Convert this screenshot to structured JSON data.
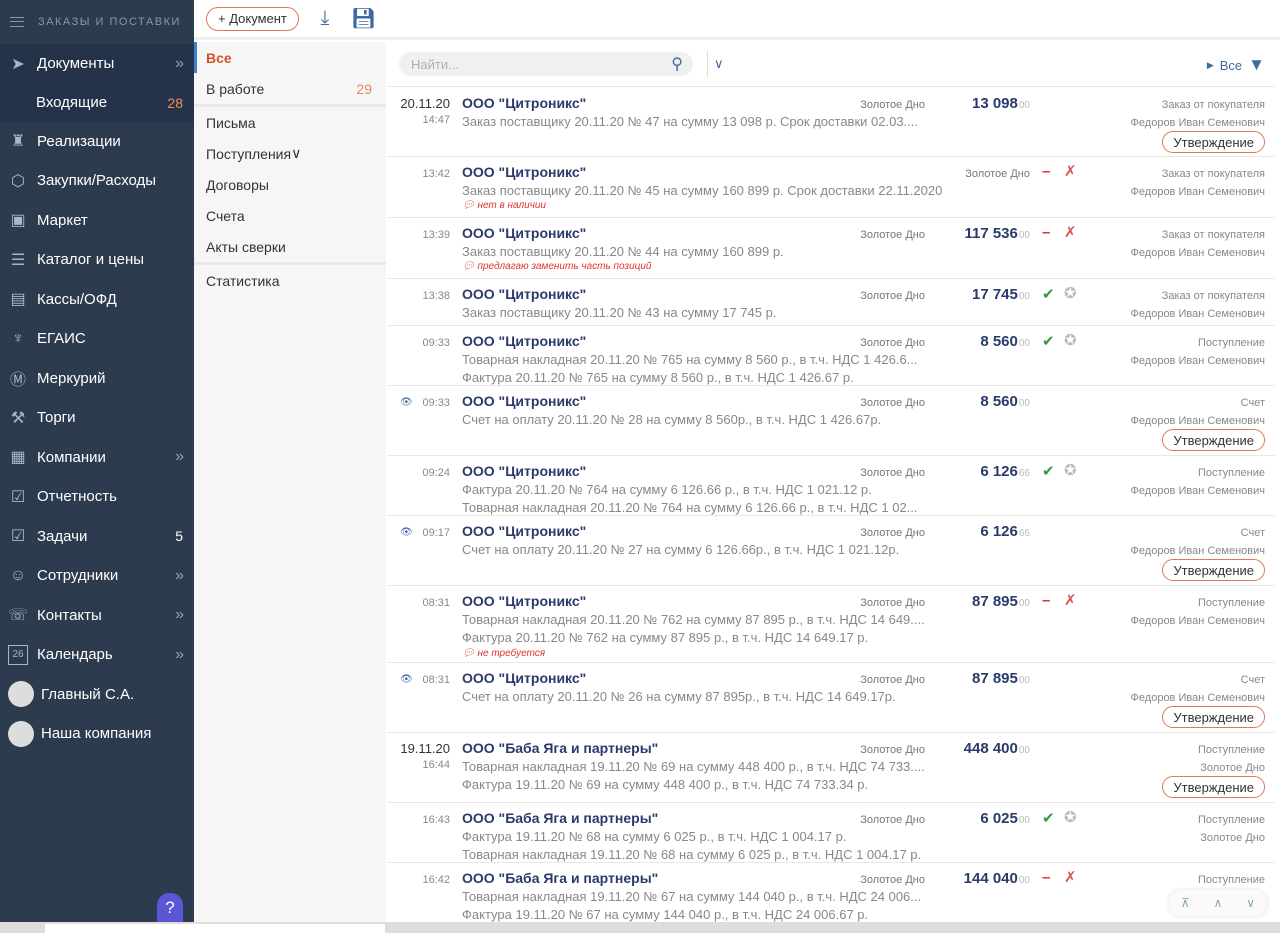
{
  "sidebar": {
    "section": "ЗАКАЗЫ И ПОСТАВКИ",
    "items": [
      {
        "label": "Документы",
        "icon": "paper-plane-icon",
        "glyph": "➤",
        "chev": true
      },
      {
        "label": "Реализации",
        "icon": "hand-coins-icon",
        "glyph": "♜"
      },
      {
        "label": "Закупки/Расходы",
        "icon": "box-icon",
        "glyph": "⬡"
      },
      {
        "label": "Маркет",
        "icon": "cart-icon",
        "glyph": "▣"
      },
      {
        "label": "Каталог и цены",
        "icon": "tray-icon",
        "glyph": "☰"
      },
      {
        "label": "Кассы/ОФД",
        "icon": "cash-register-icon",
        "glyph": "▤"
      },
      {
        "label": "ЕГАИС",
        "icon": "wine-glass-icon",
        "glyph": "♆"
      },
      {
        "label": "Меркурий",
        "icon": "mercury-icon",
        "glyph": "Ⓜ"
      },
      {
        "label": "Торги",
        "icon": "gavel-icon",
        "glyph": "⚒"
      },
      {
        "label": "Компании",
        "icon": "company-icon",
        "glyph": "▦",
        "chev": true
      },
      {
        "label": "Отчетность",
        "icon": "report-icon",
        "glyph": "☑"
      },
      {
        "label": "Задачи",
        "icon": "tasks-icon",
        "glyph": "☑",
        "count": "5"
      },
      {
        "label": "Сотрудники",
        "icon": "people-icon",
        "glyph": "☺",
        "chev": true
      },
      {
        "label": "Контакты",
        "icon": "chat-icon",
        "glyph": "☏",
        "chev": true
      },
      {
        "label": "Календарь",
        "icon": "calendar-icon",
        "glyph": "26",
        "chev": true
      },
      {
        "label": "Главный С.А.",
        "icon": "user-avatar",
        "avatar": true
      },
      {
        "label": "Наша компания",
        "icon": "company-logo",
        "avatar": true
      }
    ],
    "sub": {
      "label": "Входящие",
      "count": "28"
    },
    "help": "?"
  },
  "topbar": {
    "add_doc": "+ Документ"
  },
  "submenu": {
    "items": [
      "Все",
      "В работе",
      "Письма",
      "Поступления",
      "Договоры",
      "Счета",
      "Акты сверки",
      "Статистика"
    ],
    "in_work_count": "29"
  },
  "toolbar": {
    "search_placeholder": "Найти...",
    "filter": "Все"
  },
  "rows": [
    {
      "date": "20.11.20",
      "time": "14:47",
      "title": "ООО \"Цитроникс\"",
      "org": "Золотое Дно",
      "amt": "13 098",
      "cents": "00",
      "l1": "Заказ поставщику 20.11.20 № 47 на сумму 13 098 р. Срок доставки 02.03....",
      "r1": "Заказ от покупателя",
      "r2": "Федоров Иван Семенович",
      "appr": "Утверждение",
      "h": 69
    },
    {
      "time": "13:42",
      "title": "ООО \"Цитроникс\"",
      "org": "Золотое Дно",
      "wide": true,
      "st": "no",
      "l1": "Заказ поставщику 20.11.20 № 45 на сумму 160 899 р. Срок доставки 22.11.2020",
      "cmt": "нет в наличии",
      "r1": "Заказ от покупателя",
      "r2": "Федоров Иван Семенович",
      "h": 61
    },
    {
      "time": "13:39",
      "title": "ООО \"Цитроникс\"",
      "org": "Золотое Дно",
      "amt": "117 536",
      "cents": "00",
      "st": "no",
      "l1": "Заказ поставщику 20.11.20 № 44 на сумму 160 899 р.",
      "cmt": "предлагаю заменить часть позиций",
      "r1": "Заказ от покупателя",
      "r2": "Федоров Иван Семенович",
      "h": 61
    },
    {
      "time": "13:38",
      "title": "ООО \"Цитроникс\"",
      "org": "Золотое Дно",
      "amt": "17 745",
      "cents": "00",
      "st": "ok",
      "l1": "Заказ поставщику 20.11.20 № 43 на сумму 17 745 р.",
      "r1": "Заказ от покупателя",
      "r2": "Федоров Иван Семенович",
      "h": 47
    },
    {
      "time": "09:33",
      "title": "ООО \"Цитроникс\"",
      "org": "Золотое Дно",
      "amt": "8 560",
      "cents": "00",
      "st": "ok",
      "l1": "Товарная накладная 20.11.20 № 765 на сумму 8 560 р., в т.ч. НДС 1 426.6...",
      "l2": "Фактура 20.11.20 № 765 на сумму 8 560 р., в т.ч. НДС 1 426.67 р.",
      "r1": "Поступление",
      "r2": "Федоров Иван Семенович",
      "h": 60
    },
    {
      "eye": true,
      "time": "09:33",
      "title": "ООО \"Цитроникс\"",
      "org": "Золотое Дно",
      "amt": "8 560",
      "cents": "00",
      "l1": "Счет на оплату 20.11.20 № 28 на сумму 8 560р., в т.ч. НДС 1 426.67р.",
      "r1": "Счет",
      "r2": "Федоров Иван Семенович",
      "appr": "Утверждение",
      "h": 70
    },
    {
      "time": "09:24",
      "title": "ООО \"Цитроникс\"",
      "org": "Золотое Дно",
      "amt": "6 126",
      "cents": "66",
      "st": "ok",
      "l1": "Фактура 20.11.20 № 764 на сумму 6 126.66 р., в т.ч. НДС 1 021.12 р.",
      "l2": "Товарная накладная 20.11.20 № 764 на сумму 6 126.66 р., в т.ч. НДС 1 02...",
      "r1": "Поступление",
      "r2": "Федоров Иван Семенович",
      "h": 60
    },
    {
      "eye": true,
      "time": "09:17",
      "title": "ООО \"Цитроникс\"",
      "org": "Золотое Дно",
      "amt": "6 126",
      "cents": "66",
      "l1": "Счет на оплату 20.11.20 № 27 на сумму 6 126.66р., в т.ч. НДС 1 021.12р.",
      "r1": "Счет",
      "r2": "Федоров Иван Семенович",
      "appr": "Утверждение",
      "h": 70
    },
    {
      "time": "08:31",
      "title": "ООО \"Цитроникс\"",
      "org": "Золотое Дно",
      "amt": "87 895",
      "cents": "00",
      "st": "no",
      "l1": "Товарная накладная 20.11.20 № 762 на сумму 87 895 р., в т.ч. НДС 14 649....",
      "l2": "Фактура 20.11.20 № 762 на сумму 87 895 р., в т.ч. НДС 14 649.17 р.",
      "cmt": "не требуется",
      "r1": "Поступление",
      "r2": "Федоров Иван Семенович",
      "h": 77
    },
    {
      "eye": true,
      "time": "08:31",
      "title": "ООО \"Цитроникс\"",
      "org": "Золотое Дно",
      "amt": "87 895",
      "cents": "00",
      "l1": "Счет на оплату 20.11.20 № 26 на сумму 87 895р., в т.ч. НДС 14 649.17р.",
      "r1": "Счет",
      "r2": "Федоров Иван Семенович",
      "appr": "Утверждение",
      "h": 70
    },
    {
      "date": "19.11.20",
      "time": "16:44",
      "title": "ООО \"Баба Яга и партнеры\"",
      "org": "Золотое Дно",
      "amt": "448 400",
      "cents": "00",
      "l1": "Товарная накладная 19.11.20 № 69 на сумму 448 400 р., в т.ч. НДС 74 733....",
      "l2": "Фактура 19.11.20 № 69 на сумму 448 400 р., в т.ч. НДС 74 733.34 р.",
      "r1": "Поступление",
      "r2": "Золотое Дно",
      "appr": "Утверждение",
      "h": 70
    },
    {
      "time": "16:43",
      "title": "ООО \"Баба Яга и партнеры\"",
      "org": "Золотое Дно",
      "amt": "6 025",
      "cents": "00",
      "st": "ok",
      "l1": "Фактура 19.11.20 № 68 на сумму 6 025 р., в т.ч. НДС 1 004.17 р.",
      "l2": "Товарная накладная 19.11.20 № 68 на сумму 6 025 р., в т.ч. НДС 1 004.17 р.",
      "r1": "Поступление",
      "r2": "Золотое Дно",
      "h": 60
    },
    {
      "time": "16:42",
      "title": "ООО \"Баба Яга и партнеры\"",
      "org": "Золотое Дно",
      "amt": "144 040",
      "cents": "00",
      "st": "no",
      "l1": "Товарная накладная 19.11.20 № 67 на сумму 144 040 р., в т.ч. НДС 24 006...",
      "l2": "Фактура 19.11.20 № 67 на сумму 144 040 р., в т.ч. НДС 24 006.67 р.",
      "r1": "Поступление",
      "h": 60
    }
  ]
}
